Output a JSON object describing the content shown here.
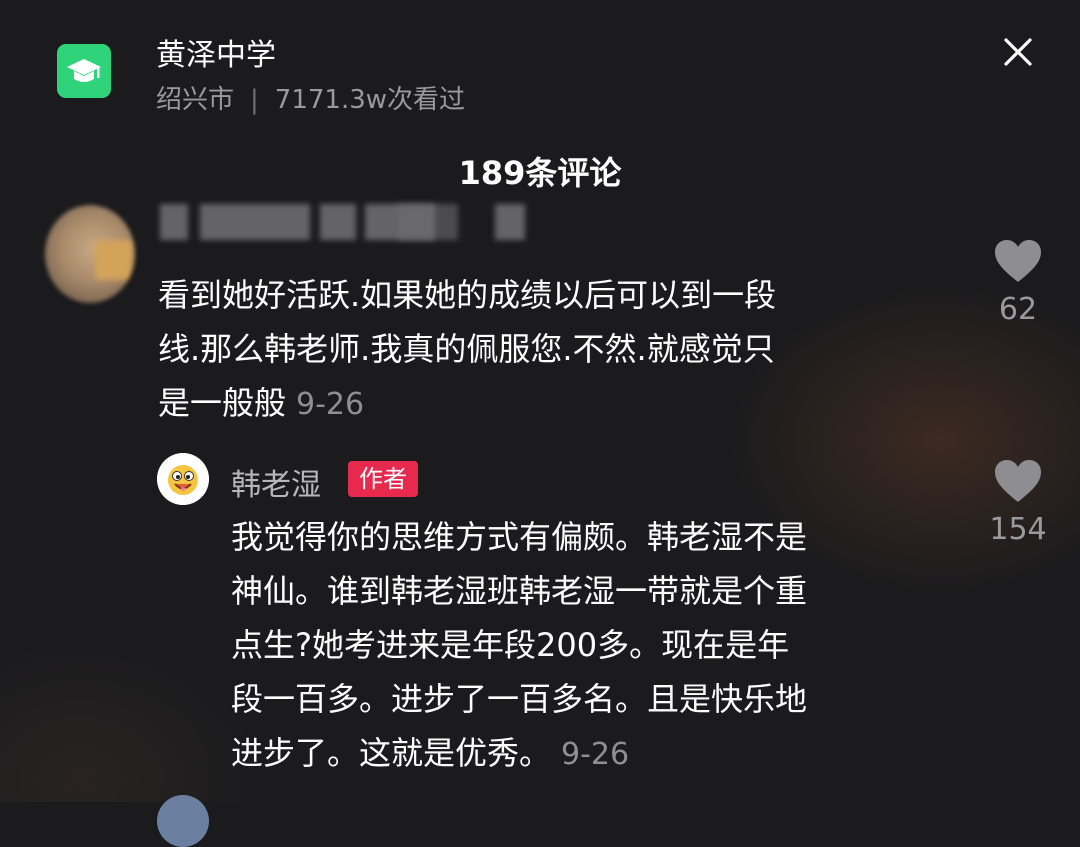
{
  "header": {
    "title": "黄泽中学",
    "location": "绍兴市",
    "separator": "|",
    "views": "7171.3w次看过",
    "app_icon": "graduation-cap-icon",
    "close_icon": "close-icon"
  },
  "comments_title": "189条评论",
  "comments": [
    {
      "author": "",
      "lines": [
        "看到她好活跃.如果她的成绩以后可以到一段",
        "线.那么韩老师.我真的佩服您.不然.就感觉只",
        "是一般般"
      ],
      "date": "9-26",
      "likes": "62"
    }
  ],
  "reply": {
    "author": "韩老湿",
    "badge": "作者",
    "lines": [
      "我觉得你的思维方式有偏颇。韩老湿不是",
      "神仙。谁到韩老湿班韩老湿一带就是个重",
      "点生?她考进来是年段200多。现在是年",
      "段一百多。进步了一百多名。且是快乐地",
      "进步了。这就是优秀。"
    ],
    "date": "9-26",
    "likes": "154"
  },
  "colors": {
    "background": "#1b1b1d",
    "app_icon": "#2ed37a",
    "badge": "#e8294e",
    "muted_text": "#9a9a9e"
  }
}
